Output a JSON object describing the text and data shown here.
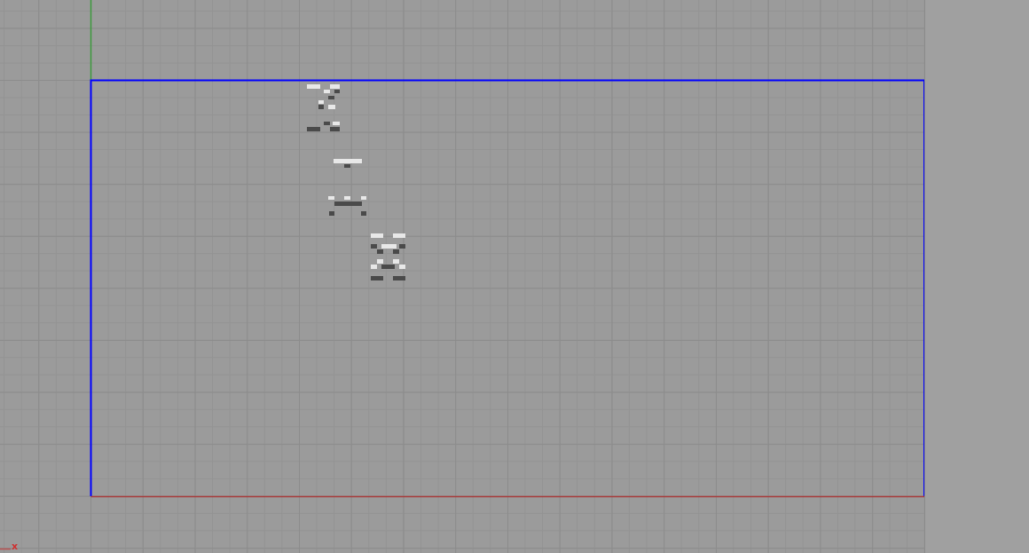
{
  "viewport": {
    "axis_label": "x"
  }
}
